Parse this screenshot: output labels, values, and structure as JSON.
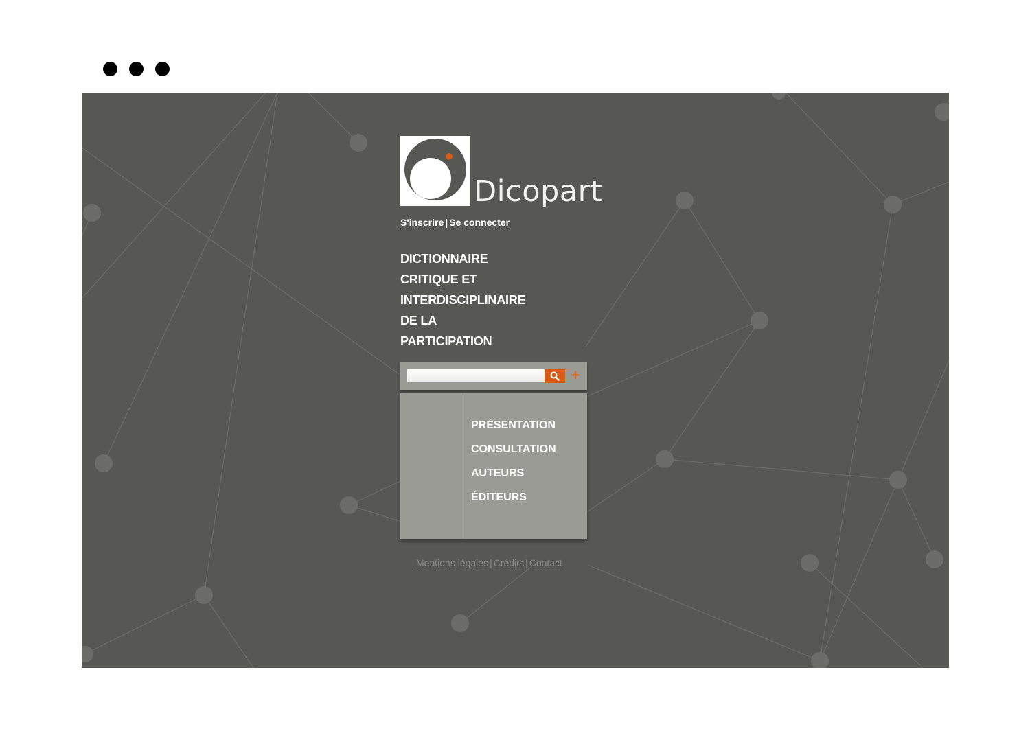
{
  "brand": {
    "name": "Dicopart",
    "accent_color": "#d95b13",
    "background_color": "#575753",
    "panel_color": "#9b9b95"
  },
  "auth": {
    "register_label": "S'inscrire",
    "separator": "|",
    "login_label": "Se connecter"
  },
  "tagline": {
    "lines": [
      "DICTIONNAIRE",
      "CRITIQUE ET",
      "INTERDISCIPLINAIRE",
      "DE LA",
      "PARTICIPATION"
    ]
  },
  "search": {
    "value": "",
    "button_icon": "search-icon",
    "advanced_label": "+"
  },
  "menu": {
    "items": [
      {
        "label": "PRÉSENTATION"
      },
      {
        "label": "CONSULTATION"
      },
      {
        "label": "AUTEURS"
      },
      {
        "label": "ÉDITEURS"
      }
    ]
  },
  "footer": {
    "legal_label": "Mentions légales",
    "credits_label": "Crédits",
    "contact_label": "Contact",
    "separator": "|"
  }
}
